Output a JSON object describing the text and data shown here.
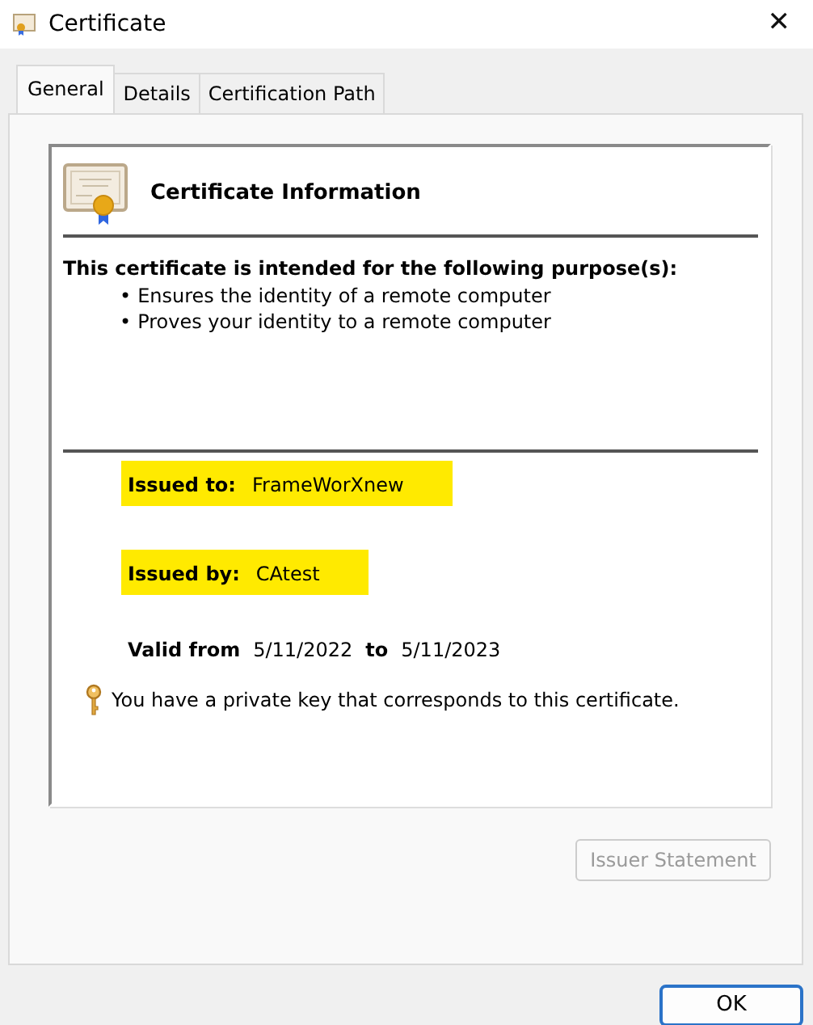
{
  "window": {
    "title": "Certificate",
    "close": "✕"
  },
  "tabs": [
    {
      "label": "General",
      "selected": true
    },
    {
      "label": "Details",
      "selected": false
    },
    {
      "label": "Certification Path",
      "selected": false
    }
  ],
  "info": {
    "heading": "Certificate Information",
    "purpose_title": "This certificate is intended for the following purpose(s):",
    "bullet": "•",
    "purposes": [
      "Ensures the identity of a remote computer",
      "Proves your identity to a remote computer"
    ],
    "fields": [
      {
        "label": "Issued to:",
        "value": "FrameWorXnew",
        "highlighted": true
      },
      {
        "label": "Issued by:",
        "value": "CAtest",
        "highlighted": true
      }
    ],
    "valid": {
      "from_label": "Valid from",
      "from": "5/11/2022",
      "to_label": "to",
      "to": "5/11/2023"
    },
    "key_note": "You have a private key that corresponds to this certificate."
  },
  "issuer_button": {
    "label": "Issuer Statement",
    "disabled": true
  },
  "ok_button": {
    "label": "OK"
  }
}
